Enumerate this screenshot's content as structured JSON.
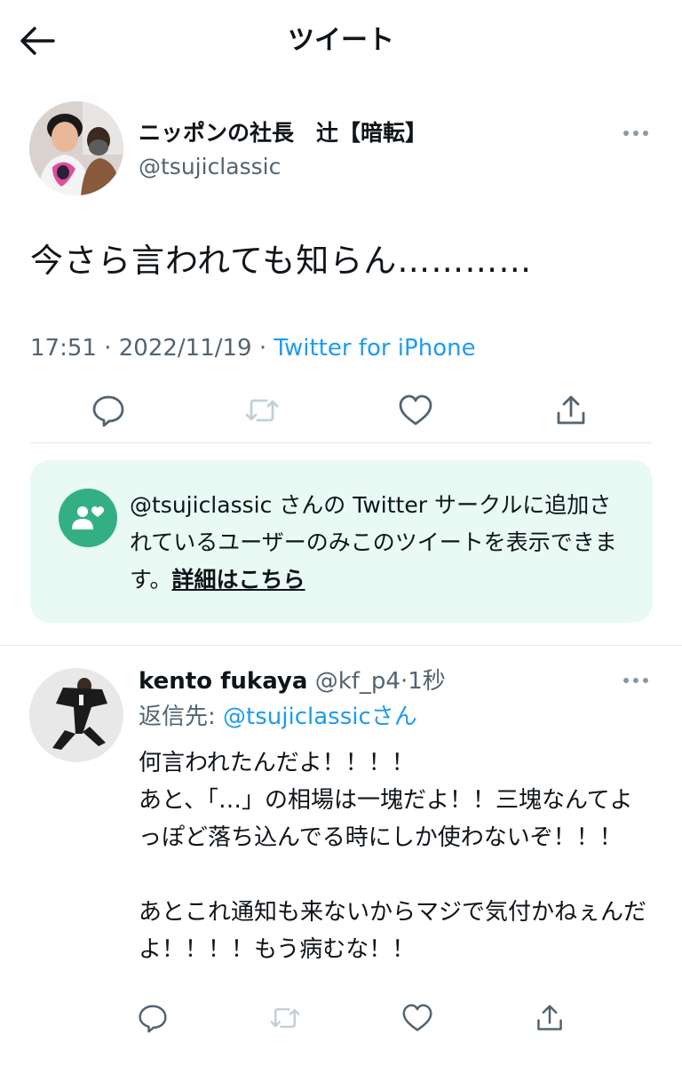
{
  "header": {
    "title": "ツイート",
    "back_icon": "arrow-left-icon"
  },
  "tweet": {
    "author_name": "ニッポンの社長　辻【暗転】",
    "author_handle": "@tsujiclassic",
    "text": "今さら言われても知らん…………",
    "time": "17:51",
    "date": "2022/11/19",
    "separator": "·",
    "source": "Twitter for iPhone",
    "actions": [
      "reply-icon",
      "retweet-icon",
      "like-icon",
      "share-icon"
    ]
  },
  "circle_notice": {
    "icon": "circle-people-heart-icon",
    "text_before": "@tsujiclassic さんの Twitter サークルに追加されているユーザーのみこのツイートを表示できます。",
    "link": "詳細はこちら",
    "accent": "#33b083",
    "background": "#e9faf4"
  },
  "reply": {
    "author_name": "kento fukaya",
    "author_handle": "@kf_p4",
    "separator": "·",
    "time": "1秒",
    "replying_to_label": "返信先: ",
    "replying_to_handle": "@tsujiclassic",
    "replying_to_suffix": "さん",
    "text": "何言われたんだよ！！！！\nあと、「…」の相場は一塊だよ！！三塊なんてよっぽど落ち込んでる時にしか使わないぞ！！！\n\nあとこれ通知も来ないからマジで気付かねぇんだよ！！！！もう病むな！！"
  },
  "colors": {
    "link": "#1d9bf0",
    "secondary_text": "#536471",
    "primary_text": "#0f1419",
    "disabled_icon": "#c4cfd6"
  }
}
